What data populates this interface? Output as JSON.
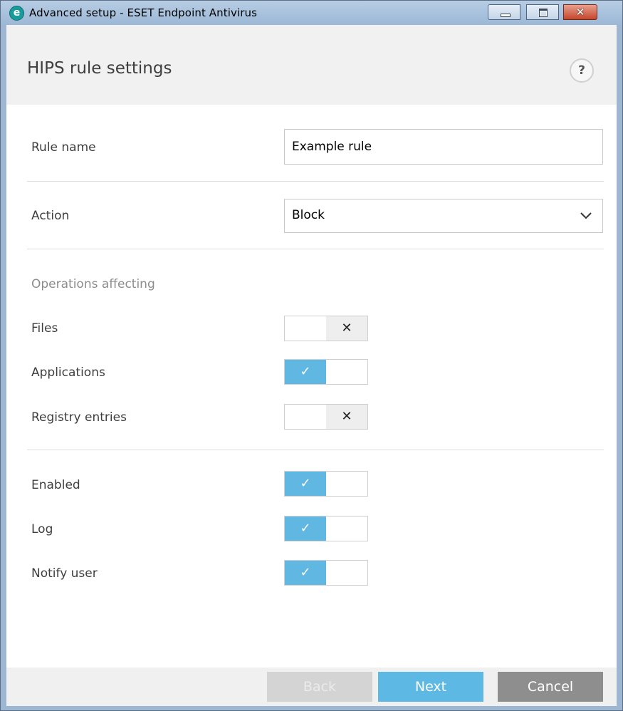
{
  "window": {
    "title": "Advanced setup - ESET Endpoint Antivirus",
    "app_icon_letter": "e"
  },
  "header": {
    "title": "HIPS rule settings",
    "help_glyph": "?"
  },
  "form": {
    "rule_name": {
      "label": "Rule name",
      "value": "Example rule"
    },
    "action": {
      "label": "Action",
      "value": "Block"
    },
    "operations_label": "Operations affecting",
    "operations": [
      {
        "label": "Files",
        "state": "off"
      },
      {
        "label": "Applications",
        "state": "on"
      },
      {
        "label": "Registry entries",
        "state": "off"
      }
    ],
    "options": [
      {
        "label": "Enabled",
        "state": "on"
      },
      {
        "label": "Log",
        "state": "on"
      },
      {
        "label": "Notify user",
        "state": "on"
      }
    ]
  },
  "footer": {
    "back_label": "Back",
    "next_label": "Next",
    "cancel_label": "Cancel"
  },
  "colors": {
    "accent": "#5db8e3",
    "toggle_on": "#60b8e2",
    "cancel": "#8e8e8e",
    "disabled": "#d4d4d4"
  },
  "icons": {
    "help": "help-icon",
    "dropdown": "chevron-down-icon",
    "toggle_on": "check-icon",
    "toggle_off": "x-icon"
  }
}
